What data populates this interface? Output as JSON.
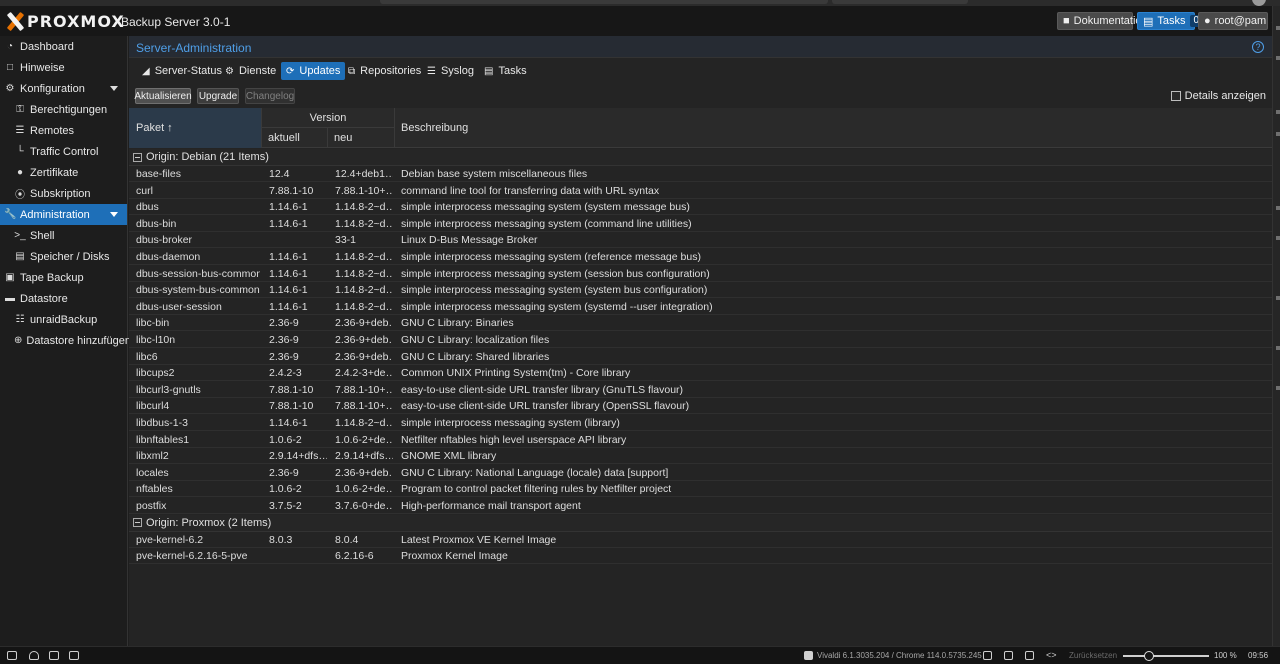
{
  "header": {
    "brand": "PROXMOX",
    "product": "Backup Server 3.0-1",
    "docs_label": "Dokumentation",
    "tasks_label": "Tasks",
    "tasks_count": "0",
    "user_label": "root@pam"
  },
  "sidebar": {
    "items": [
      {
        "label": "Dashboard",
        "icon": "tachometer-icon"
      },
      {
        "label": "Hinweise",
        "icon": "note-icon"
      },
      {
        "label": "Konfiguration",
        "icon": "gears-icon"
      },
      {
        "label": "Berechtigungen",
        "icon": "key-icon"
      },
      {
        "label": "Remotes",
        "icon": "server-icon"
      },
      {
        "label": "Traffic Control",
        "icon": "chart-icon"
      },
      {
        "label": "Zertifikate",
        "icon": "certificate-icon"
      },
      {
        "label": "Subskription",
        "icon": "lifebuoy-icon"
      },
      {
        "label": "Administration",
        "icon": "wrench-icon"
      },
      {
        "label": "Shell",
        "icon": "terminal-icon"
      },
      {
        "label": "Speicher / Disks",
        "icon": "hdd-icon"
      },
      {
        "label": "Tape Backup",
        "icon": "tape-icon"
      },
      {
        "label": "Datastore",
        "icon": "archive-icon"
      },
      {
        "label": "unraidBackup",
        "icon": "database-icon"
      },
      {
        "label": "Datastore hinzufügen",
        "icon": "plus-circle-icon"
      }
    ]
  },
  "panel": {
    "title": "Server-Administration",
    "tabs": [
      {
        "label": "Server-Status",
        "icon": "area-chart-icon"
      },
      {
        "label": "Dienste",
        "icon": "cogs-icon"
      },
      {
        "label": "Updates",
        "icon": "refresh-icon"
      },
      {
        "label": "Repositories",
        "icon": "files-icon"
      },
      {
        "label": "Syslog",
        "icon": "list-icon"
      },
      {
        "label": "Tasks",
        "icon": "list-alt-icon"
      }
    ]
  },
  "toolbar": {
    "refresh_label": "Aktualisieren",
    "upgrade_label": "Upgrade",
    "changelog_label": "Changelog",
    "details_label": "Details anzeigen"
  },
  "grid": {
    "col_package": "Paket ↑",
    "col_version": "Version",
    "col_current": "aktuell",
    "col_new": "neu",
    "col_desc": "Beschreibung",
    "groups": [
      {
        "title": "Origin: Debian (21 Items)",
        "rows": [
          {
            "name": "base-files",
            "cur": "12.4",
            "new": "12.4+deb1…",
            "desc": "Debian base system miscellaneous files"
          },
          {
            "name": "curl",
            "cur": "7.88.1-10",
            "new": "7.88.1-10+…",
            "desc": "command line tool for transferring data with URL syntax"
          },
          {
            "name": "dbus",
            "cur": "1.14.6-1",
            "new": "1.14.8-2~d…",
            "desc": "simple interprocess messaging system (system message bus)"
          },
          {
            "name": "dbus-bin",
            "cur": "1.14.6-1",
            "new": "1.14.8-2~d…",
            "desc": "simple interprocess messaging system (command line utilities)"
          },
          {
            "name": "dbus-broker",
            "cur": "",
            "new": "33-1",
            "desc": "Linux D-Bus Message Broker"
          },
          {
            "name": "dbus-daemon",
            "cur": "1.14.6-1",
            "new": "1.14.8-2~d…",
            "desc": "simple interprocess messaging system (reference message bus)"
          },
          {
            "name": "dbus-session-bus-common",
            "cur": "1.14.6-1",
            "new": "1.14.8-2~d…",
            "desc": "simple interprocess messaging system (session bus configuration)"
          },
          {
            "name": "dbus-system-bus-common",
            "cur": "1.14.6-1",
            "new": "1.14.8-2~d…",
            "desc": "simple interprocess messaging system (system bus configuration)"
          },
          {
            "name": "dbus-user-session",
            "cur": "1.14.6-1",
            "new": "1.14.8-2~d…",
            "desc": "simple interprocess messaging system (systemd --user integration)"
          },
          {
            "name": "libc-bin",
            "cur": "2.36-9",
            "new": "2.36-9+deb…",
            "desc": "GNU C Library: Binaries"
          },
          {
            "name": "libc-l10n",
            "cur": "2.36-9",
            "new": "2.36-9+deb…",
            "desc": "GNU C Library: localization files"
          },
          {
            "name": "libc6",
            "cur": "2.36-9",
            "new": "2.36-9+deb…",
            "desc": "GNU C Library: Shared libraries"
          },
          {
            "name": "libcups2",
            "cur": "2.4.2-3",
            "new": "2.4.2-3+de…",
            "desc": "Common UNIX Printing System(tm) - Core library"
          },
          {
            "name": "libcurl3-gnutls",
            "cur": "7.88.1-10",
            "new": "7.88.1-10+…",
            "desc": "easy-to-use client-side URL transfer library (GnuTLS flavour)"
          },
          {
            "name": "libcurl4",
            "cur": "7.88.1-10",
            "new": "7.88.1-10+…",
            "desc": "easy-to-use client-side URL transfer library (OpenSSL flavour)"
          },
          {
            "name": "libdbus-1-3",
            "cur": "1.14.6-1",
            "new": "1.14.8-2~d…",
            "desc": "simple interprocess messaging system (library)"
          },
          {
            "name": "libnftables1",
            "cur": "1.0.6-2",
            "new": "1.0.6-2+de…",
            "desc": "Netfilter nftables high level userspace API library"
          },
          {
            "name": "libxml2",
            "cur": "2.9.14+dfs…",
            "new": "2.9.14+dfs…",
            "desc": "GNOME XML library"
          },
          {
            "name": "locales",
            "cur": "2.36-9",
            "new": "2.36-9+deb…",
            "desc": "GNU C Library: National Language (locale) data [support]"
          },
          {
            "name": "nftables",
            "cur": "1.0.6-2",
            "new": "1.0.6-2+de…",
            "desc": "Program to control packet filtering rules by Netfilter project"
          },
          {
            "name": "postfix",
            "cur": "3.7.5-2",
            "new": "3.7.6-0+de…",
            "desc": "High-performance mail transport agent"
          }
        ]
      },
      {
        "title": "Origin: Proxmox (2 Items)",
        "rows": [
          {
            "name": "pve-kernel-6.2",
            "cur": "8.0.3",
            "new": "8.0.4",
            "desc": "Latest Proxmox VE Kernel Image"
          },
          {
            "name": "pve-kernel-6.2.16-5-pve",
            "cur": "",
            "new": "6.2.16-6",
            "desc": "Proxmox Kernel Image"
          }
        ]
      }
    ]
  },
  "taskbar": {
    "browser_version": "Vivaldi 6.1.3035.204 / Chrome 114.0.5735.245",
    "reset_label": "Zurücksetzen",
    "zoom": "100 %",
    "zoom_level": 1.0,
    "time": "09:56"
  },
  "colors": {
    "accent": "#1e6fb8",
    "brand_orange": "#e57000",
    "title_blue": "#4f9fe8"
  }
}
